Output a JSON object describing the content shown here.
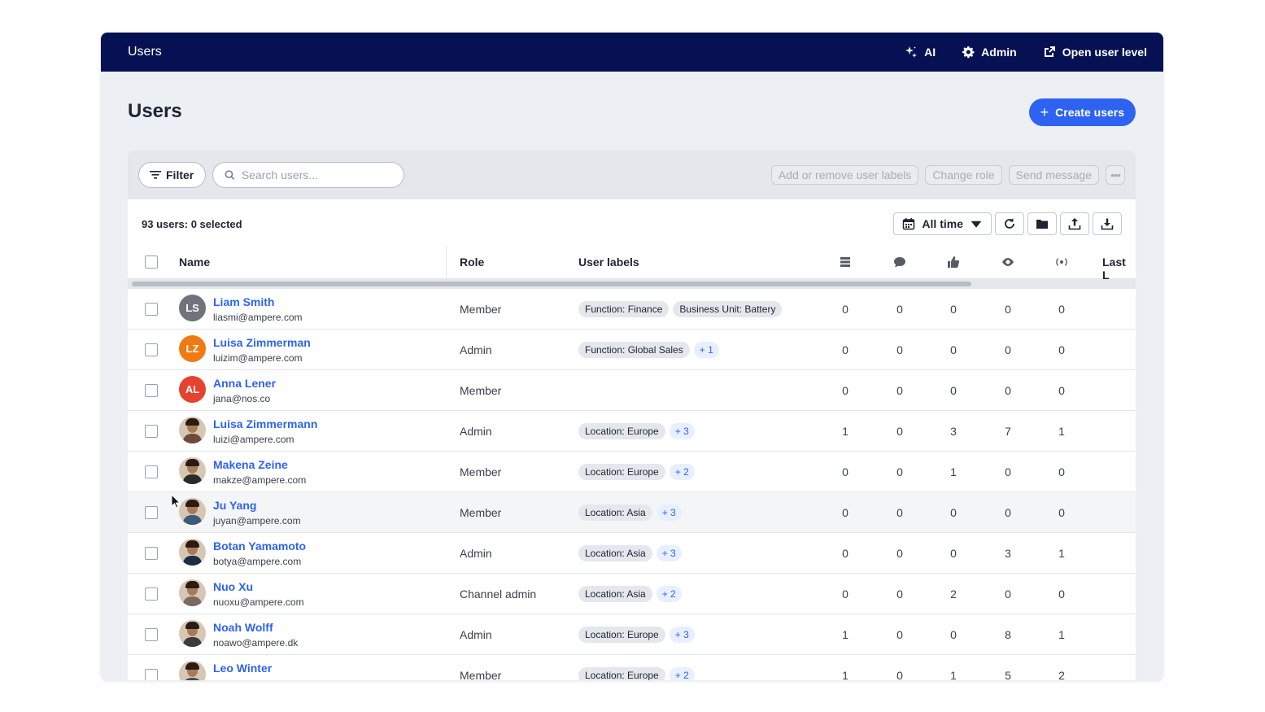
{
  "topbar": {
    "title": "Users",
    "ai_label": "AI",
    "admin_label": "Admin",
    "open_label": "Open user level"
  },
  "page": {
    "title": "Users",
    "create_label": "Create users"
  },
  "toolbar": {
    "filter_label": "Filter",
    "search_placeholder": "Search users...",
    "actions": [
      "Add or remove user labels",
      "Change role",
      "Send message"
    ],
    "more_label": "•••"
  },
  "summary": {
    "text": "93 users: 0 selected",
    "period_label": "All time"
  },
  "columns": {
    "name": "Name",
    "role": "Role",
    "labels": "User labels",
    "metric_icons": [
      "posts-icon",
      "comments-icon",
      "likes-icon",
      "views-icon",
      "broadcast-icon"
    ],
    "last": "Last L"
  },
  "users": [
    {
      "name": "Liam Smith",
      "email": "liasmi@ampere.com",
      "role": "Member",
      "initials": "LS",
      "avatar_color": "#6e737d",
      "labels": [
        "Function: Finance",
        "Business Unit: Battery"
      ],
      "more": "",
      "metrics": [
        "0",
        "0",
        "0",
        "0",
        "0"
      ]
    },
    {
      "name": "Luisa Zimmerman",
      "email": "luizim@ampere.com",
      "role": "Admin",
      "initials": "LZ",
      "avatar_color": "#f07a12",
      "labels": [
        "Function: Global Sales"
      ],
      "more": "+ 1",
      "metrics": [
        "0",
        "0",
        "0",
        "0",
        "0"
      ]
    },
    {
      "name": "Anna Lener",
      "email": "jana@nos.co",
      "role": "Member",
      "initials": "AL",
      "avatar_color": "#e5432e",
      "labels": [],
      "more": "",
      "metrics": [
        "0",
        "0",
        "0",
        "0",
        "0"
      ]
    },
    {
      "name": "Luisa Zimmermann",
      "email": "luizi@ampere.com",
      "role": "Admin",
      "initials": "",
      "avatar_color": "#6d4b3a",
      "labels": [
        "Location: Europe"
      ],
      "more": "+ 3",
      "metrics": [
        "1",
        "0",
        "3",
        "7",
        "1"
      ]
    },
    {
      "name": "Makena Zeine",
      "email": "makze@ampere.com",
      "role": "Member",
      "initials": "",
      "avatar_color": "#2a2a2a",
      "labels": [
        "Location: Europe"
      ],
      "more": "+ 2",
      "metrics": [
        "0",
        "0",
        "1",
        "0",
        "0"
      ]
    },
    {
      "name": "Ju Yang",
      "email": "juyan@ampere.com",
      "role": "Member",
      "initials": "",
      "avatar_color": "#3c5a7a",
      "labels": [
        "Location: Asia"
      ],
      "more": "+ 3",
      "metrics": [
        "0",
        "0",
        "0",
        "0",
        "0"
      ]
    },
    {
      "name": "Botan Yamamoto",
      "email": "botya@ampere.com",
      "role": "Admin",
      "initials": "",
      "avatar_color": "#1f2a44",
      "labels": [
        "Location: Asia"
      ],
      "more": "+ 3",
      "metrics": [
        "0",
        "0",
        "0",
        "3",
        "1"
      ]
    },
    {
      "name": "Nuo Xu",
      "email": "nuoxu@ampere.com",
      "role": "Channel admin",
      "initials": "",
      "avatar_color": "#7c6a5e",
      "labels": [
        "Location: Asia"
      ],
      "more": "+ 2",
      "metrics": [
        "0",
        "0",
        "2",
        "0",
        "0"
      ]
    },
    {
      "name": "Noah Wolff",
      "email": "noawo@ampere.dk",
      "role": "Admin",
      "initials": "",
      "avatar_color": "#3b3b3b",
      "labels": [
        "Location: Europe"
      ],
      "more": "+ 3",
      "metrics": [
        "1",
        "0",
        "0",
        "8",
        "1"
      ]
    },
    {
      "name": "Leo Winter",
      "email": "",
      "role": "Member",
      "initials": "",
      "avatar_color": "#4a4a52",
      "labels": [
        "Location: Europe"
      ],
      "more": "+ 2",
      "metrics": [
        "1",
        "0",
        "1",
        "5",
        "2"
      ]
    }
  ]
}
